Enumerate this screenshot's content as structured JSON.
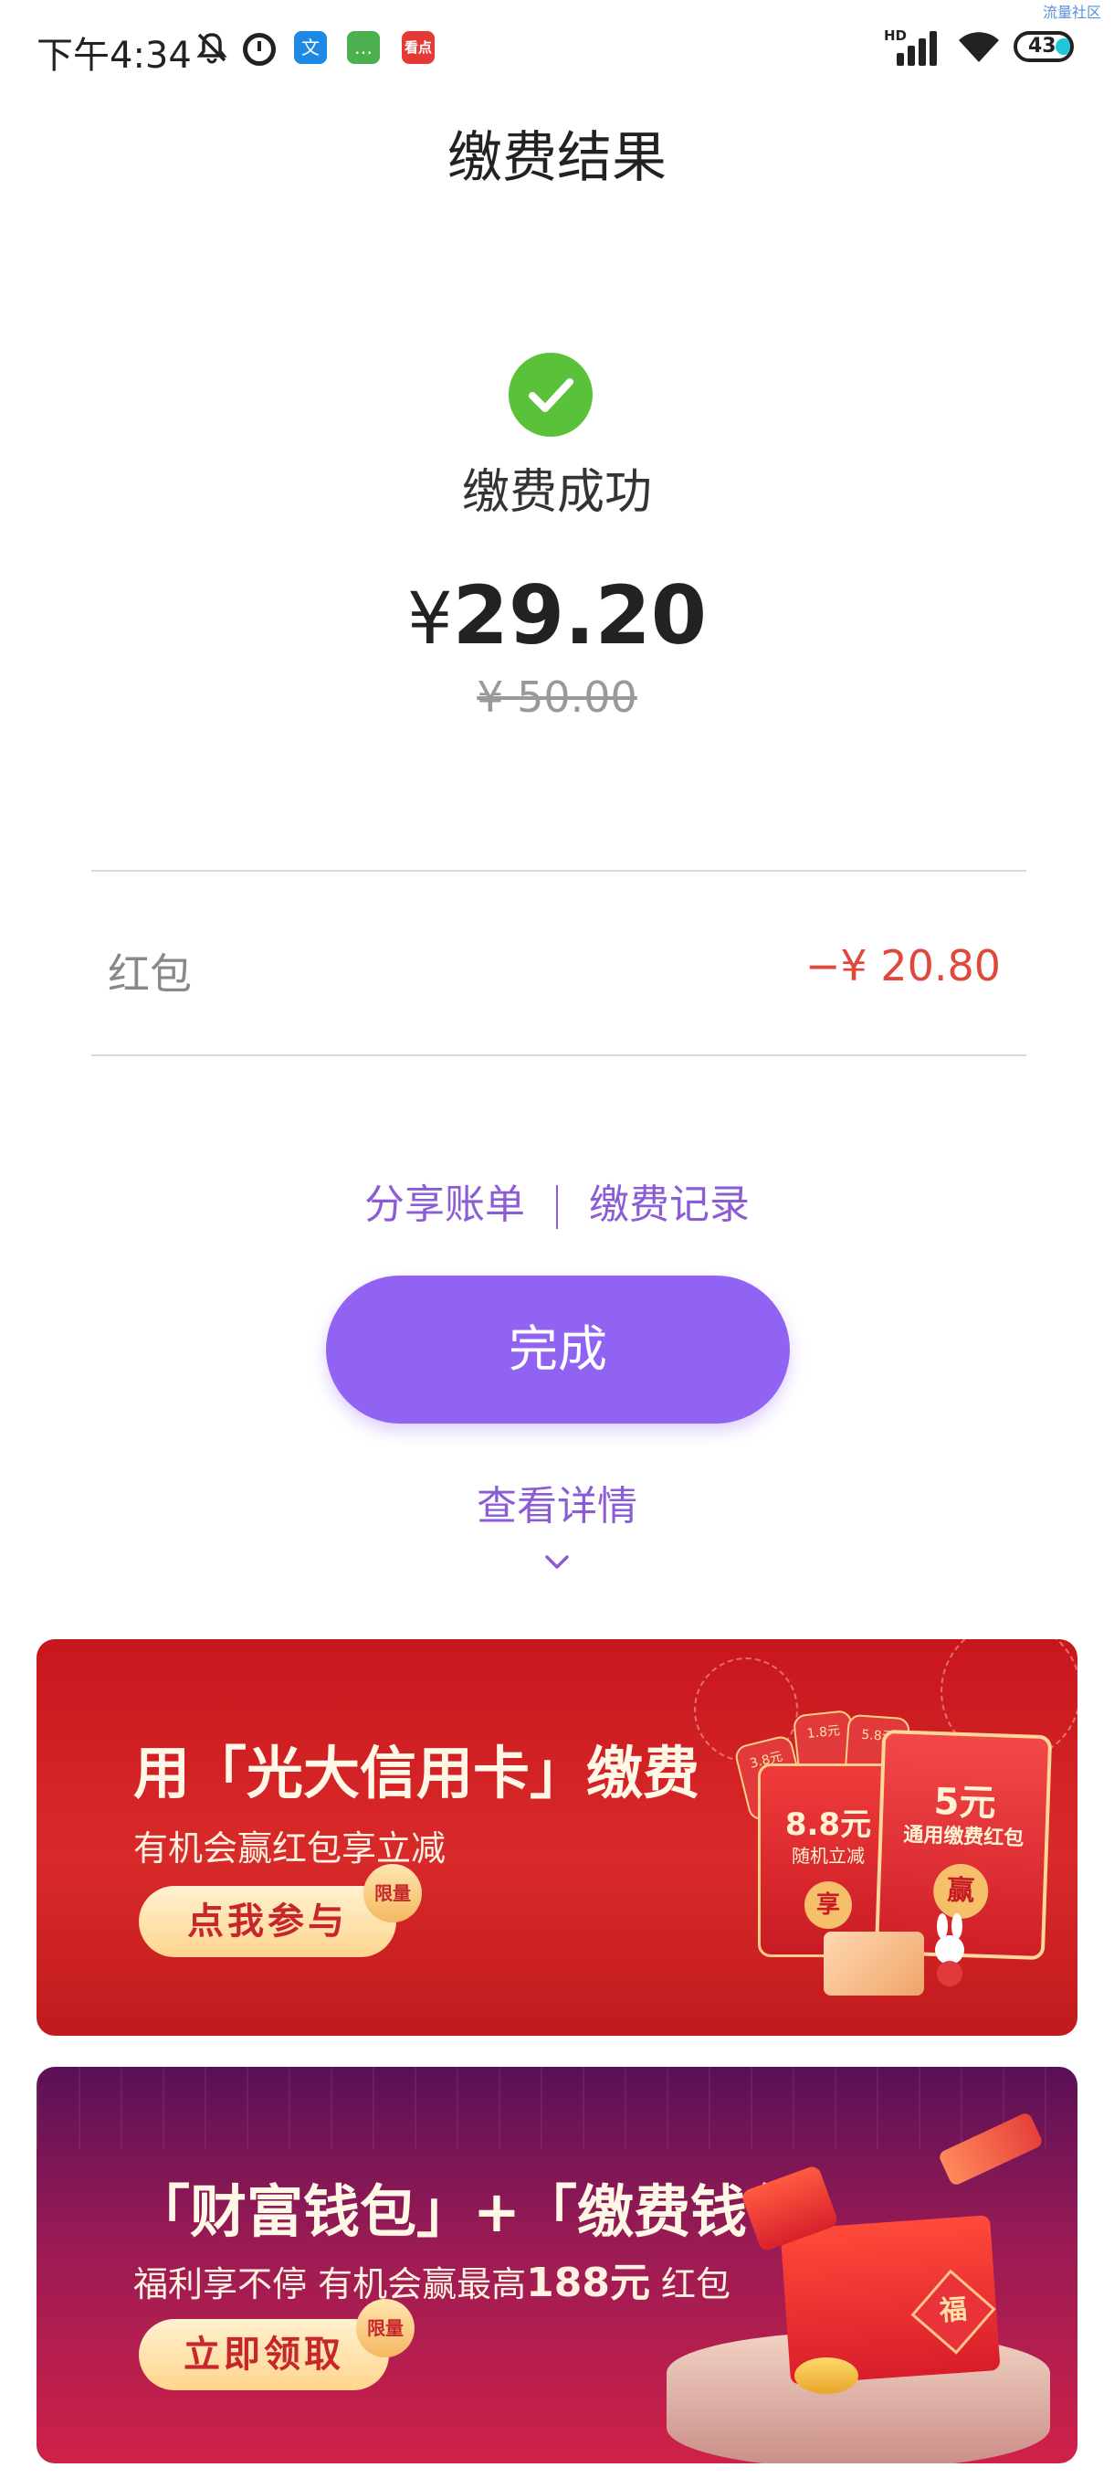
{
  "status_bar": {
    "time": "下午4:34",
    "icons": [
      "bell-off-icon",
      "clock-icon",
      "app-translate-icon",
      "app-message-icon",
      "app-news-icon",
      "signal-icon",
      "wifi-icon",
      "battery-icon"
    ],
    "app1_glyph": "文",
    "app2_glyph": "…",
    "app3_glyph": "看点",
    "signal_label": "HD",
    "battery_level": "43",
    "watermark": "流量社区"
  },
  "header": {
    "title": "缴费结果"
  },
  "result": {
    "status": "缴费成功",
    "currency": "¥",
    "amount": "29.20",
    "original_amount": "¥ 50.00"
  },
  "discount": {
    "label": "红包",
    "value": "−¥ 20.80"
  },
  "links": {
    "share": "分享账单",
    "records": "缴费记录"
  },
  "done_button": "完成",
  "details_link": "查看详情",
  "banners": [
    {
      "title": "用「光大信用卡」缴费",
      "subtitle": "有机会赢红包享立减",
      "button": "点我参与",
      "badge": "限量",
      "card_left_amount": "8.8元",
      "card_left_caption": "随机立减",
      "card_left_seal": "享",
      "card_right_amount": "5元",
      "card_right_caption": "通用缴费红包",
      "card_right_seal": "赢",
      "mini_card_1": "3.8元",
      "mini_card_2": "1.8元",
      "mini_card_3": "5.8元"
    },
    {
      "title": "「财富钱包」+「缴费钱包」",
      "subtitle_prefix": "福利享不停 有机会赢最高",
      "subtitle_highlight": "188元",
      "subtitle_suffix": "红包",
      "button": "立即领取",
      "badge": "限量",
      "box_seal": "福"
    }
  ],
  "colors": {
    "accent": "#9163f2",
    "link": "#8c5cd6",
    "success": "#5ac23a",
    "discount": "#e0483b"
  }
}
